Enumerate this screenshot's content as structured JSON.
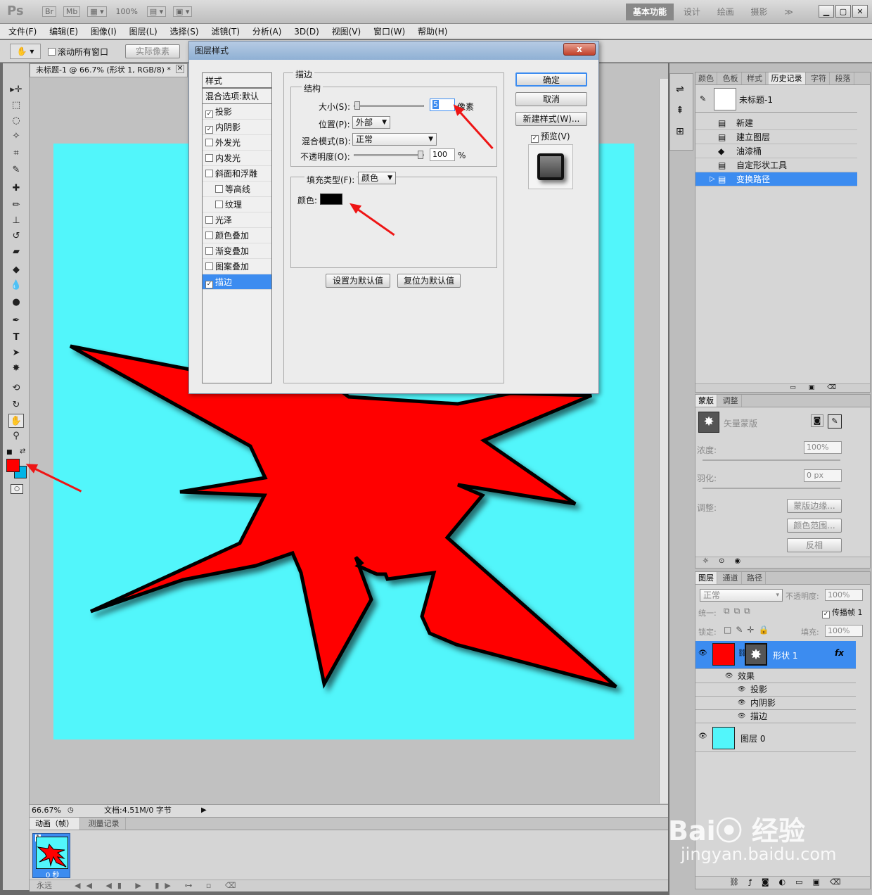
{
  "app": {
    "logo": "Ps",
    "br": "Br",
    "mb": "Mb",
    "zoom": "100%"
  },
  "workspace": {
    "items": [
      "基本功能",
      "设计",
      "绘画",
      "摄影"
    ],
    "more": "≫"
  },
  "menu": [
    "文件(F)",
    "编辑(E)",
    "图像(I)",
    "图层(L)",
    "选择(S)",
    "滤镜(T)",
    "分析(A)",
    "3D(D)",
    "视图(V)",
    "窗口(W)",
    "帮助(H)"
  ],
  "options": {
    "scroll_all": "滚动所有窗口",
    "actual_pixels": "实际像素"
  },
  "document": {
    "tab_title": "未标题-1 @ 66.7% (形状 1, RGB/8) *",
    "zoom": "66.67%",
    "doc_size": "文档:4.51M/0 字节",
    "bg_color": "#52f6fb"
  },
  "colors": {
    "foreground": "#ff0000",
    "background": "#00b4e6",
    "shape_fill": "#ff0000",
    "stroke": "#000000"
  },
  "animation": {
    "tabs": [
      "动画（帧）",
      "测量记录"
    ],
    "frame_number": "1",
    "frame_time": "0 秒",
    "loop": "永远"
  },
  "dialog": {
    "title": "图层样式",
    "styles_header": "样式",
    "blend_options": "混合选项:默认",
    "items": [
      {
        "label": "投影",
        "checked": true
      },
      {
        "label": "内阴影",
        "checked": true
      },
      {
        "label": "外发光",
        "checked": false
      },
      {
        "label": "内发光",
        "checked": false
      },
      {
        "label": "斜面和浮雕",
        "checked": false
      },
      {
        "label": "等高线",
        "checked": false
      },
      {
        "label": "纹理",
        "checked": false
      },
      {
        "label": "光泽",
        "checked": false
      },
      {
        "label": "颜色叠加",
        "checked": false
      },
      {
        "label": "渐变叠加",
        "checked": false
      },
      {
        "label": "图案叠加",
        "checked": false
      },
      {
        "label": "描边",
        "checked": true
      }
    ],
    "stroke_title": "描边",
    "structure_title": "结构",
    "size_label": "大小(S):",
    "size_value": "5",
    "size_unit": "像素",
    "position_label": "位置(P):",
    "position_value": "外部",
    "blend_mode_label": "混合模式(B):",
    "blend_mode_value": "正常",
    "opacity_label": "不透明度(O):",
    "opacity_value": "100",
    "opacity_unit": "%",
    "fill_type_label": "填充类型(F):",
    "fill_type_value": "颜色",
    "color_label": "颜色:",
    "set_default": "设置为默认值",
    "reset_default": "复位为默认值",
    "ok": "确定",
    "cancel": "取消",
    "new_style": "新建样式(W)...",
    "preview": "预览(V)",
    "preview_checked": true,
    "close": "x"
  },
  "history": {
    "tabs": [
      "颜色",
      "色板",
      "样式",
      "历史记录",
      "字符",
      "段落"
    ],
    "snapshot": "未标题-1",
    "items": [
      {
        "label": "新建"
      },
      {
        "label": "建立图层"
      },
      {
        "label": "油漆桶"
      },
      {
        "label": "自定形状工具"
      },
      {
        "label": "变换路径"
      }
    ]
  },
  "masks": {
    "tabs": [
      "蒙版",
      "调整"
    ],
    "vector_mask": "矢量蒙版",
    "density_label": "浓度:",
    "density_value": "100%",
    "feather_label": "羽化:",
    "feather_value": "0 px",
    "adjust_label": "调整:",
    "mask_edge": "蒙版边缘...",
    "color_range": "颜色范围...",
    "invert": "反相"
  },
  "layers": {
    "tabs": [
      "图层",
      "通道",
      "路径"
    ],
    "blend_mode": "正常",
    "opacity_label": "不透明度:",
    "opacity_value": "100%",
    "unify_label": "统一:",
    "propagate": "传播帧 1",
    "lock_label": "锁定:",
    "fill_label": "填充:",
    "fill_value": "100%",
    "shape_layer": "形状 1",
    "effects": "效果",
    "effect_items": [
      "投影",
      "内阴影",
      "描边"
    ],
    "layer0": "图层 0",
    "fx": "fx"
  }
}
